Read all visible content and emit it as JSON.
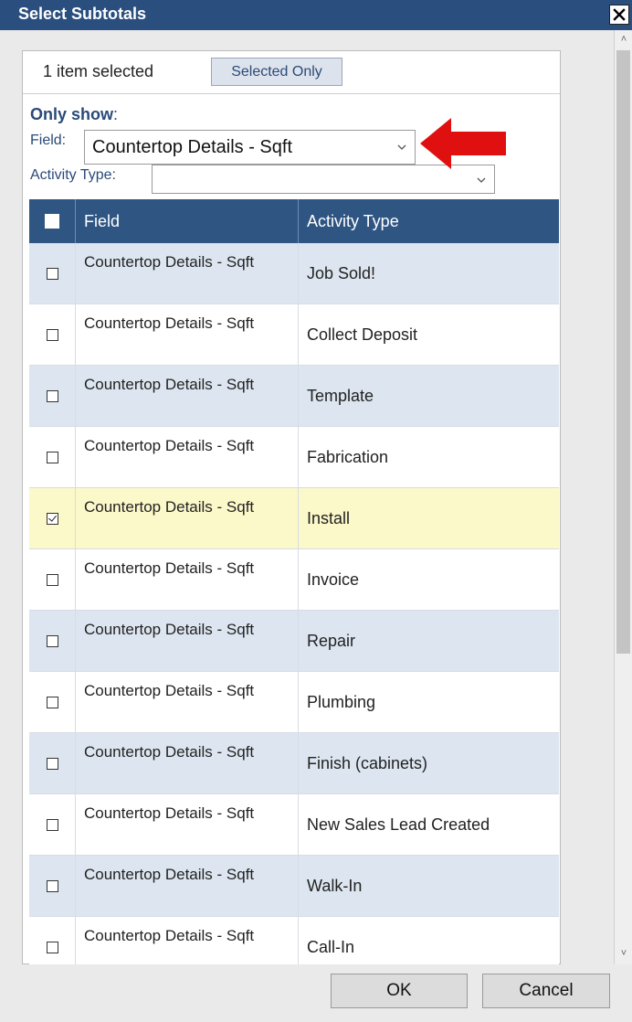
{
  "dialog": {
    "title": "Select Subtotals",
    "close_icon": "close-icon"
  },
  "selection": {
    "count_text": "1 item selected",
    "selected_only_label": "Selected Only"
  },
  "filters": {
    "heading": "Only show",
    "heading_colon": ":",
    "field_label": "Field:",
    "field_value": "Countertop Details - Sqft",
    "activity_label": "Activity Type:",
    "activity_value": ""
  },
  "table": {
    "headers": {
      "field": "Field",
      "activity": "Activity Type"
    },
    "rows": [
      {
        "field": "Countertop Details - Sqft",
        "activity": "Job Sold!",
        "checked": false
      },
      {
        "field": "Countertop Details - Sqft",
        "activity": "Collect Deposit",
        "checked": false
      },
      {
        "field": "Countertop Details - Sqft",
        "activity": "Template",
        "checked": false
      },
      {
        "field": "Countertop Details - Sqft",
        "activity": "Fabrication",
        "checked": false
      },
      {
        "field": "Countertop Details - Sqft",
        "activity": "Install",
        "checked": true
      },
      {
        "field": "Countertop Details - Sqft",
        "activity": "Invoice",
        "checked": false
      },
      {
        "field": "Countertop Details - Sqft",
        "activity": "Repair",
        "checked": false
      },
      {
        "field": "Countertop Details - Sqft",
        "activity": "Plumbing",
        "checked": false
      },
      {
        "field": "Countertop Details - Sqft",
        "activity": "Finish (cabinets)",
        "checked": false
      },
      {
        "field": "Countertop Details - Sqft",
        "activity": "New Sales Lead Created",
        "checked": false
      },
      {
        "field": "Countertop Details - Sqft",
        "activity": "Walk-In",
        "checked": false
      },
      {
        "field": "Countertop Details - Sqft",
        "activity": "Call-In",
        "checked": false
      }
    ]
  },
  "buttons": {
    "ok": "OK",
    "cancel": "Cancel"
  },
  "colors": {
    "header": "#2a4f7e",
    "accent_arrow": "#e01010",
    "checked_row": "#fbf8c9"
  }
}
